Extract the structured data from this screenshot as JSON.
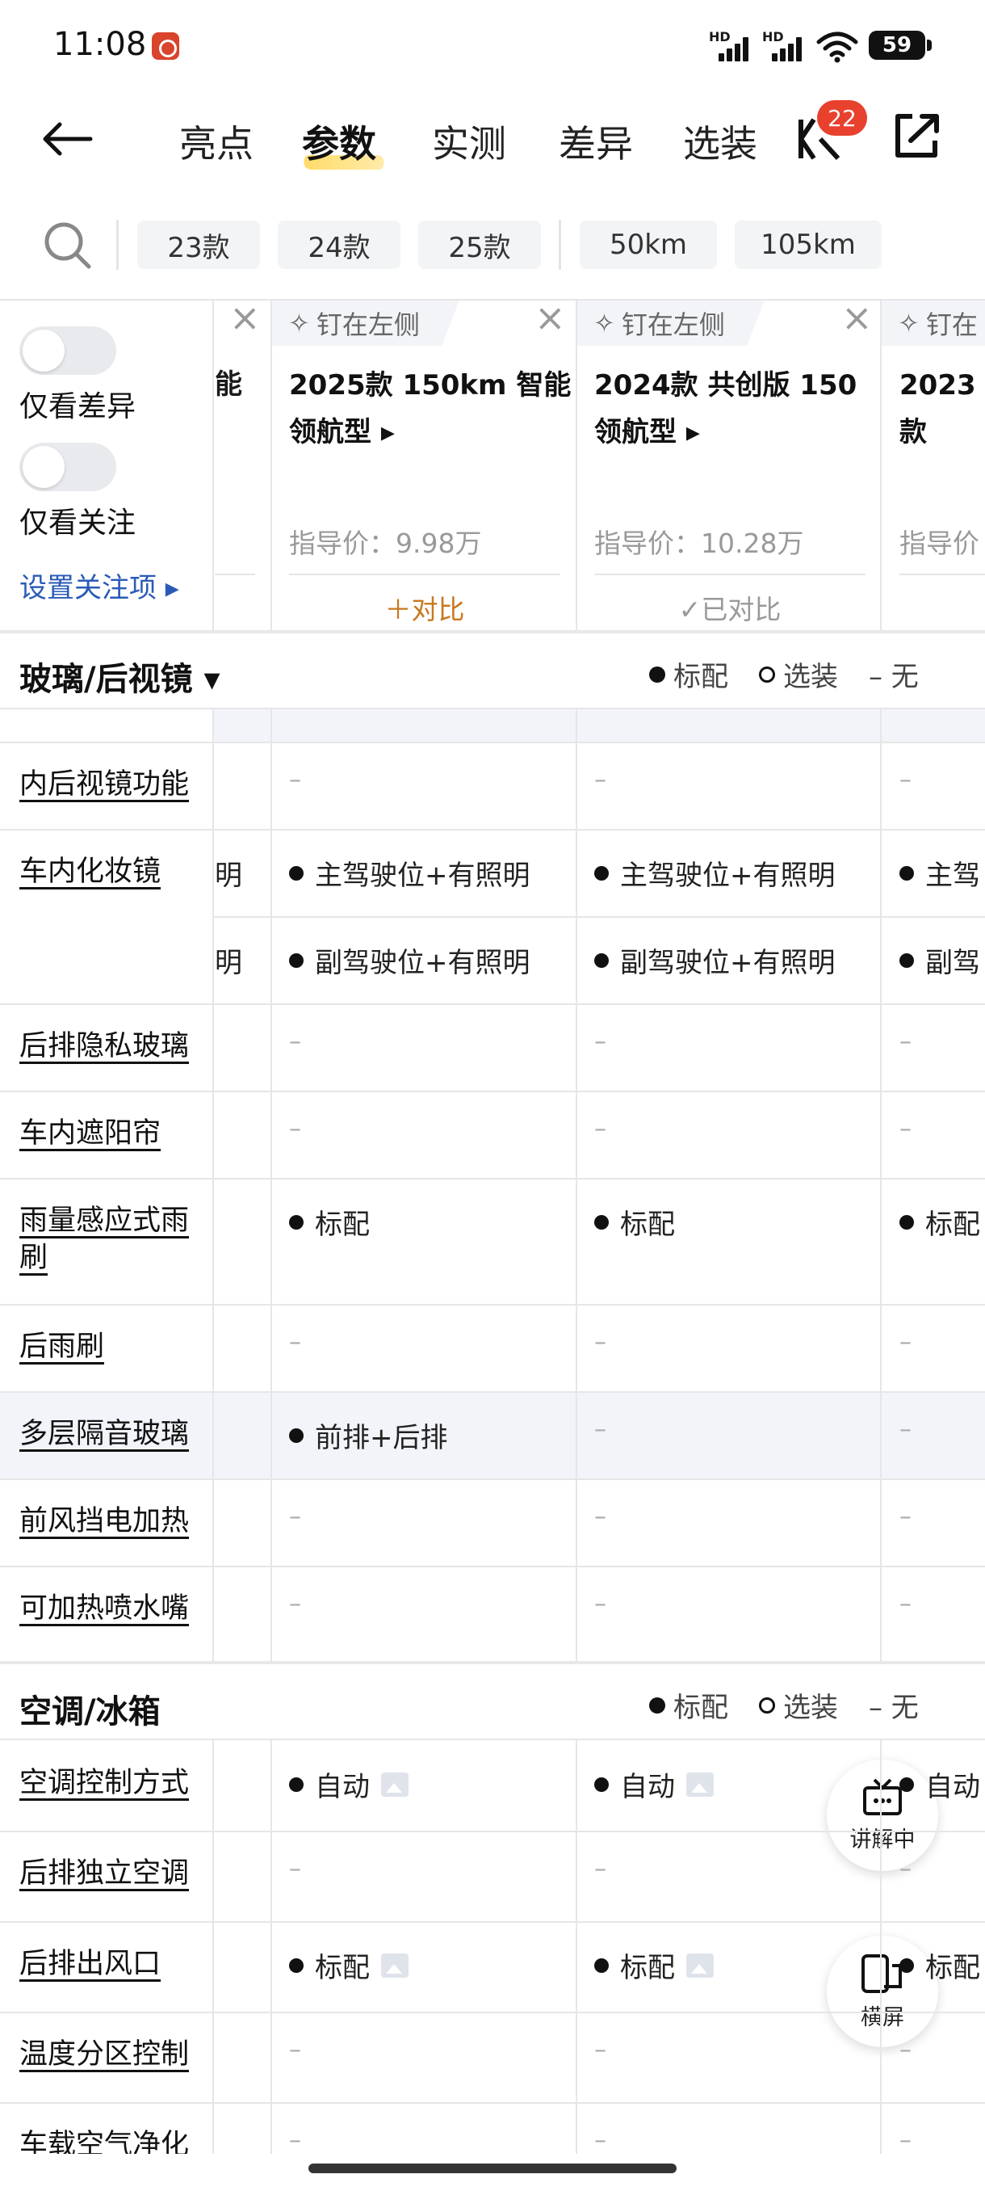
{
  "status": {
    "time": "11:08",
    "battery": "59",
    "signal1_label": "HD",
    "signal2_label": "HD"
  },
  "nav": {
    "tabs": [
      {
        "label": "亮点"
      },
      {
        "label": "参数"
      },
      {
        "label": "实测"
      },
      {
        "label": "差异"
      },
      {
        "label": "选装"
      }
    ],
    "active_tab": "参数",
    "badge_count": "22"
  },
  "filters": {
    "years": [
      "23款",
      "24款",
      "25款"
    ],
    "ranges": [
      "50km",
      "105km"
    ]
  },
  "left_panel": {
    "toggle1_label": "仅看差异",
    "toggle2_label": "仅看关注",
    "settings_link": "设置关注项 ▸",
    "partial_label": "能"
  },
  "cars": [
    {
      "pin_label": "钉在左侧",
      "name_line1": "2025款 150km 智能",
      "name_line2": "领航型 ▸",
      "price": "指导价：9.98万",
      "action": "＋对比",
      "action_color": "#c8781f"
    },
    {
      "pin_label": "钉在左侧",
      "name_line1": "2024款 共创版 150",
      "name_line2": "领航型 ▸",
      "price": "指导价：10.28万",
      "action": "✓已对比",
      "action_color": "#999999"
    },
    {
      "pin_label": "钉在",
      "name_line1": "2023款",
      "name_line2": "",
      "price": "指导价",
      "action": "",
      "action_color": "#999999"
    }
  ],
  "sections": [
    {
      "title": "玻璃/后视镜 ▾",
      "legend": {
        "standard": "标配",
        "optional": "选装",
        "none": "– 无"
      }
    },
    {
      "title": "空调/冰箱",
      "legend": {
        "standard": "标配",
        "optional": "选装",
        "none": "– 无"
      }
    }
  ],
  "glass_rows": [
    {
      "label": "内后视镜功能",
      "cells": [
        "–",
        "–",
        "–"
      ],
      "partial": ""
    },
    {
      "label": "车内化妆镜",
      "cells": [
        "主驾驶位+有照明",
        "主驾驶位+有照明",
        "主驾"
      ],
      "partial": "明"
    },
    {
      "label": "",
      "cells": [
        "副驾驶位+有照明",
        "副驾驶位+有照明",
        "副驾"
      ],
      "partial": "明"
    },
    {
      "label": "后排隐私玻璃",
      "cells": [
        "–",
        "–",
        "–"
      ],
      "partial": ""
    },
    {
      "label": "车内遮阳帘",
      "cells": [
        "–",
        "–",
        "–"
      ],
      "partial": ""
    },
    {
      "label": "雨量感应式雨",
      "label2": "刷",
      "cells": [
        "标配",
        "标配",
        "标配"
      ],
      "partial": ""
    },
    {
      "label": "后雨刷",
      "cells": [
        "–",
        "–",
        "–"
      ],
      "partial": ""
    },
    {
      "label": "多层隔音玻璃",
      "cells": [
        "前排+后排",
        "–",
        "–"
      ],
      "partial": ""
    },
    {
      "label": "前风挡电加热",
      "cells": [
        "–",
        "–",
        "–"
      ],
      "partial": ""
    },
    {
      "label": "可加热喷水嘴",
      "cells": [
        "–",
        "–",
        "–"
      ],
      "partial": ""
    }
  ],
  "ac_rows": [
    {
      "label": "空调控制方式",
      "cells": [
        "自动",
        "自动",
        "自动"
      ]
    },
    {
      "label": "后排独立空调",
      "cells": [
        "–",
        "–",
        "–"
      ]
    },
    {
      "label": "后排出风口",
      "cells": [
        "标配",
        "标配",
        "标配"
      ]
    },
    {
      "label": "温度分区控制",
      "cells": [
        "–",
        "–",
        "–"
      ]
    },
    {
      "label": "车载空气净化",
      "cells": [
        "–",
        "–",
        "–"
      ]
    }
  ],
  "floating": {
    "explain_label": "讲解中",
    "landscape_label": "横屏"
  },
  "colors": {
    "accent_orange": "#c8781f",
    "link_blue": "#2a5ab8",
    "badge_red": "#e8412e",
    "highlight_row": "#f2f4f9"
  }
}
